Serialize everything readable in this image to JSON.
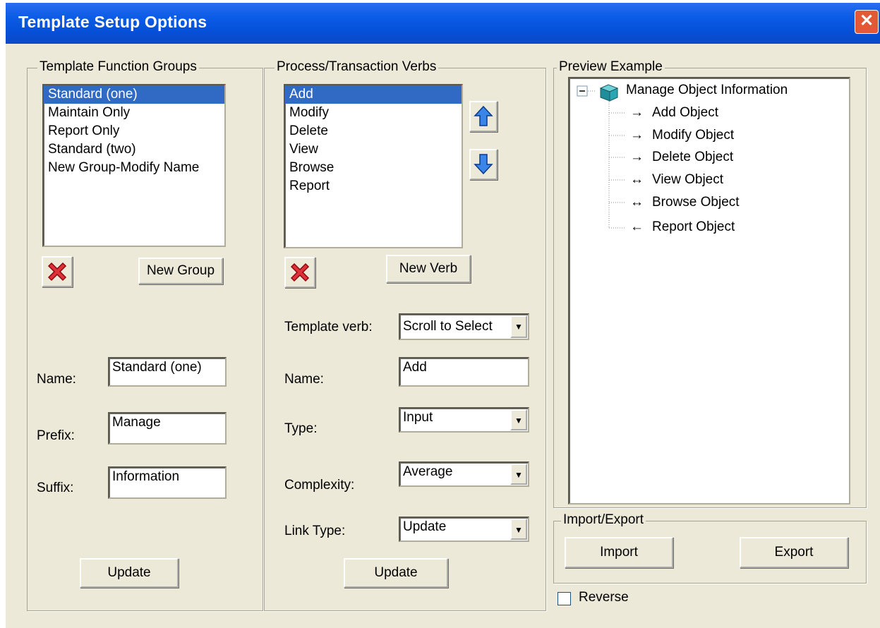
{
  "window": {
    "title": "Template Setup Options",
    "close_glyph": "✕"
  },
  "groups_panel": {
    "legend": "Template  Function Groups",
    "items": [
      "Standard  (one)",
      "Maintain Only",
      "Report Only",
      "Standard (two)",
      "New Group-Modify Name"
    ],
    "selected_index": 0,
    "delete_icon": "red-x-icon",
    "new_group_label": "New Group",
    "name_label": "Name:",
    "name_value": "Standard  (one)",
    "prefix_label": "Prefix:",
    "prefix_value": "Manage",
    "suffix_label": "Suffix:",
    "suffix_value": "Information",
    "update_label": "Update"
  },
  "verbs_panel": {
    "legend": "Process/Transaction Verbs",
    "items": [
      "Add",
      "Modify",
      "Delete",
      "View",
      "Browse",
      "Report"
    ],
    "selected_index": 0,
    "move_up_icon": "arrow-up-icon",
    "move_down_icon": "arrow-down-icon",
    "delete_icon": "red-x-icon",
    "new_verb_label": "New Verb",
    "template_verb_label": "Template verb:",
    "template_verb_value": "Scroll to Select",
    "name_label": "Name:",
    "name_value": "Add",
    "type_label": "Type:",
    "type_value": "Input",
    "complexity_label": "Complexity:",
    "complexity_value": "Average",
    "link_type_label": "Link Type:",
    "link_type_value": "Update",
    "update_label": "Update"
  },
  "preview_panel": {
    "legend": "Preview Example",
    "root_label": "Manage Object Information",
    "expander": "−",
    "children": [
      {
        "arrow": "→",
        "label": "Add Object"
      },
      {
        "arrow": "→",
        "label": "Modify Object"
      },
      {
        "arrow": "→",
        "label": "Delete Object"
      },
      {
        "arrow": "↔",
        "label": "View Object"
      },
      {
        "arrow": "↔",
        "label": "Browse Object"
      },
      {
        "arrow": "←",
        "label": "Report Object"
      }
    ]
  },
  "import_export": {
    "legend": "Import/Export",
    "import_label": "Import",
    "export_label": "Export"
  },
  "reverse": {
    "label": "Reverse",
    "checked": false
  },
  "colors": {
    "title_bar": "#0a55df",
    "dialog_bg": "#ece9d8",
    "selection": "#316ac5",
    "close_button": "#e25a35"
  }
}
